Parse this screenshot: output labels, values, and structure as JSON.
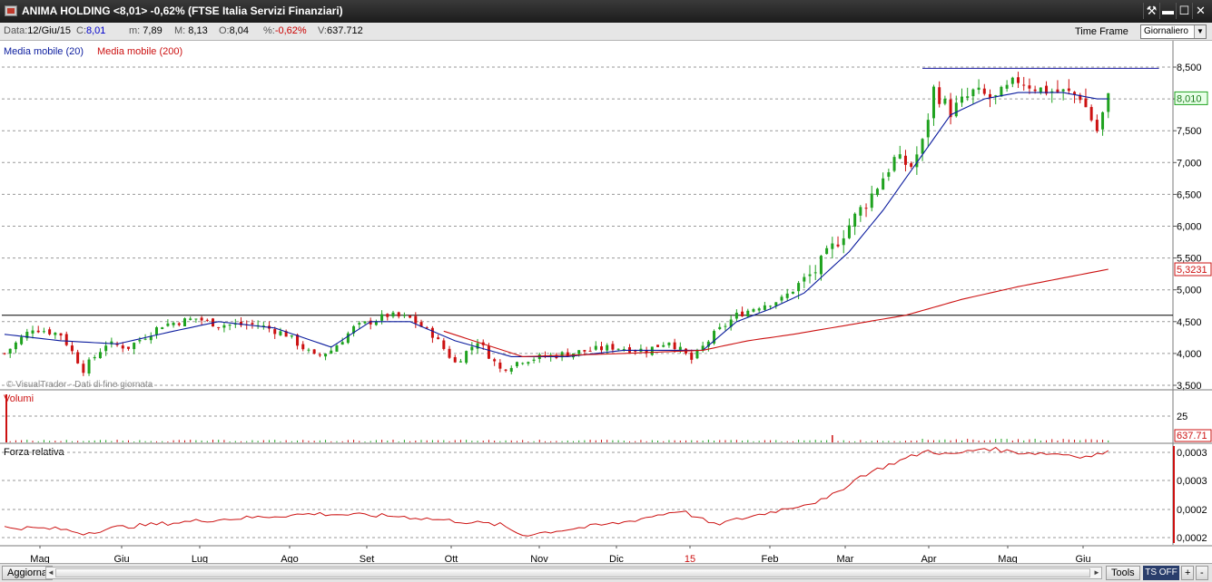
{
  "window": {
    "title": "ANIMA HOLDING <8,01> -0,62%  (FTSE Italia Servizi Finanziari)",
    "buttons": {
      "tools": "⚒",
      "minimize": "▬",
      "maximize": "☐",
      "close": "✕"
    }
  },
  "infobar": {
    "data_label": "Data:",
    "data_value": "12/Giu/15",
    "close_label": "C:",
    "close_value": "8,01",
    "min_label": "m:",
    "min_value": "7,89",
    "max_label": "M:",
    "max_value": "8,13",
    "open_label": "O:",
    "open_value": "8,04",
    "pct_label": "%:",
    "pct_value": "-0,62%",
    "vol_label": "V:",
    "vol_value": "637.712",
    "timeframe_label": "Time Frame",
    "timeframe_value": "Giornaliero"
  },
  "colors": {
    "ma20": "#0b1c9e",
    "ma200": "#cc1111",
    "candle_up": "#1fa21f",
    "candle_down": "#cc1111",
    "gridline": "#9a9a9a"
  },
  "chart_data": {
    "type": "candlestick",
    "legend": [
      "Media mobile (20)",
      "Media mobile (200)"
    ],
    "watermark": "© VisualTrader - Dati di fine giornata",
    "price_axis": {
      "ticks": [
        "8,500",
        "8,000",
        "7,500",
        "7,000",
        "6,500",
        "6,000",
        "5,500",
        "5,000",
        "4,500",
        "4,000",
        "3,500"
      ],
      "ylim": [
        3.5,
        8.5
      ],
      "last_price_label": "8,010",
      "ma200_label": "5,3231"
    },
    "x_axis": {
      "labels": [
        "Mag",
        "Giu",
        "Lug",
        "Ago",
        "Set",
        "Ott",
        "Nov",
        "Dic",
        "15",
        "Feb",
        "Mar",
        "Apr",
        "Mag",
        "Giu"
      ]
    },
    "price_series": {
      "name": "ANIMA HOLDING",
      "close_points": [
        [
          0,
          4.0
        ],
        [
          5,
          4.4
        ],
        [
          10,
          4.3
        ],
        [
          14,
          3.75
        ],
        [
          18,
          4.15
        ],
        [
          22,
          4.1
        ],
        [
          28,
          4.45
        ],
        [
          34,
          4.55
        ],
        [
          38,
          4.45
        ],
        [
          45,
          4.45
        ],
        [
          50,
          4.3
        ],
        [
          55,
          3.95
        ],
        [
          58,
          4.05
        ],
        [
          62,
          4.4
        ],
        [
          68,
          4.6
        ],
        [
          72,
          4.55
        ],
        [
          76,
          4.3
        ],
        [
          80,
          3.85
        ],
        [
          84,
          4.2
        ],
        [
          88,
          3.75
        ],
        [
          92,
          3.9
        ],
        [
          100,
          4.0
        ],
        [
          108,
          4.1
        ],
        [
          114,
          4.05
        ],
        [
          118,
          4.2
        ],
        [
          122,
          3.9
        ],
        [
          126,
          4.3
        ],
        [
          130,
          4.6
        ],
        [
          134,
          4.75
        ],
        [
          138,
          4.85
        ],
        [
          144,
          5.3
        ],
        [
          149,
          5.9
        ],
        [
          154,
          6.5
        ],
        [
          158,
          7.05
        ],
        [
          161,
          6.95
        ],
        [
          163,
          7.3
        ],
        [
          165,
          8.15
        ],
        [
          168,
          7.8
        ],
        [
          172,
          8.1
        ],
        [
          176,
          8.0
        ],
        [
          180,
          8.3
        ],
        [
          184,
          8.15
        ],
        [
          188,
          8.1
        ],
        [
          191,
          8.05
        ],
        [
          194,
          7.5
        ],
        [
          196,
          8.01
        ]
      ],
      "last_index": 196
    },
    "resistance_line": {
      "y": 8.48,
      "from_index": 163,
      "to_index": 205
    },
    "support_line": {
      "y": 4.6
    },
    "ma20_points": [
      [
        0,
        4.3
      ],
      [
        10,
        4.2
      ],
      [
        20,
        4.15
      ],
      [
        30,
        4.35
      ],
      [
        38,
        4.5
      ],
      [
        48,
        4.4
      ],
      [
        58,
        4.1
      ],
      [
        65,
        4.5
      ],
      [
        72,
        4.5
      ],
      [
        80,
        4.2
      ],
      [
        90,
        3.95
      ],
      [
        100,
        3.95
      ],
      [
        110,
        4.05
      ],
      [
        116,
        4.05
      ],
      [
        124,
        4.05
      ],
      [
        130,
        4.5
      ],
      [
        136,
        4.7
      ],
      [
        142,
        4.95
      ],
      [
        150,
        5.6
      ],
      [
        156,
        6.25
      ],
      [
        162,
        7.0
      ],
      [
        168,
        7.75
      ],
      [
        174,
        8.0
      ],
      [
        180,
        8.1
      ],
      [
        188,
        8.1
      ],
      [
        194,
        8.0
      ],
      [
        196,
        8.0
      ]
    ],
    "ma200_points": [
      [
        78,
        4.35
      ],
      [
        92,
        3.95
      ],
      [
        110,
        4.0
      ],
      [
        124,
        4.05
      ],
      [
        132,
        4.2
      ],
      [
        140,
        4.3
      ],
      [
        150,
        4.45
      ],
      [
        160,
        4.6
      ],
      [
        170,
        4.85
      ],
      [
        180,
        5.05
      ],
      [
        196,
        5.3231
      ]
    ],
    "volume_panel": {
      "label": "Volumi",
      "tick": "25",
      "last_value_label": "637.71"
    },
    "rs_panel": {
      "label": "Forza relativa",
      "ticks": [
        "0,0003",
        "0,0003",
        "0,0002",
        "0,0002"
      ],
      "points": [
        [
          0,
          0.12
        ],
        [
          10,
          0.1
        ],
        [
          14,
          0.05
        ],
        [
          20,
          0.12
        ],
        [
          35,
          0.2
        ],
        [
          55,
          0.28
        ],
        [
          70,
          0.25
        ],
        [
          88,
          0.15
        ],
        [
          92,
          0.03
        ],
        [
          110,
          0.18
        ],
        [
          120,
          0.32
        ],
        [
          126,
          0.15
        ],
        [
          136,
          0.3
        ],
        [
          146,
          0.45
        ],
        [
          152,
          0.72
        ],
        [
          158,
          0.88
        ],
        [
          164,
          1.02
        ],
        [
          168,
          0.97
        ],
        [
          174,
          1.05
        ],
        [
          180,
          1.0
        ],
        [
          188,
          0.98
        ],
        [
          192,
          0.95
        ],
        [
          196,
          1.0
        ]
      ]
    },
    "x_range": [
      0,
      207
    ]
  },
  "bottombar": {
    "refresh_button": "Aggiorna",
    "tools_button": "Tools",
    "ts_button": "TS OFF",
    "plus_button": "+",
    "minus_button": "-"
  }
}
